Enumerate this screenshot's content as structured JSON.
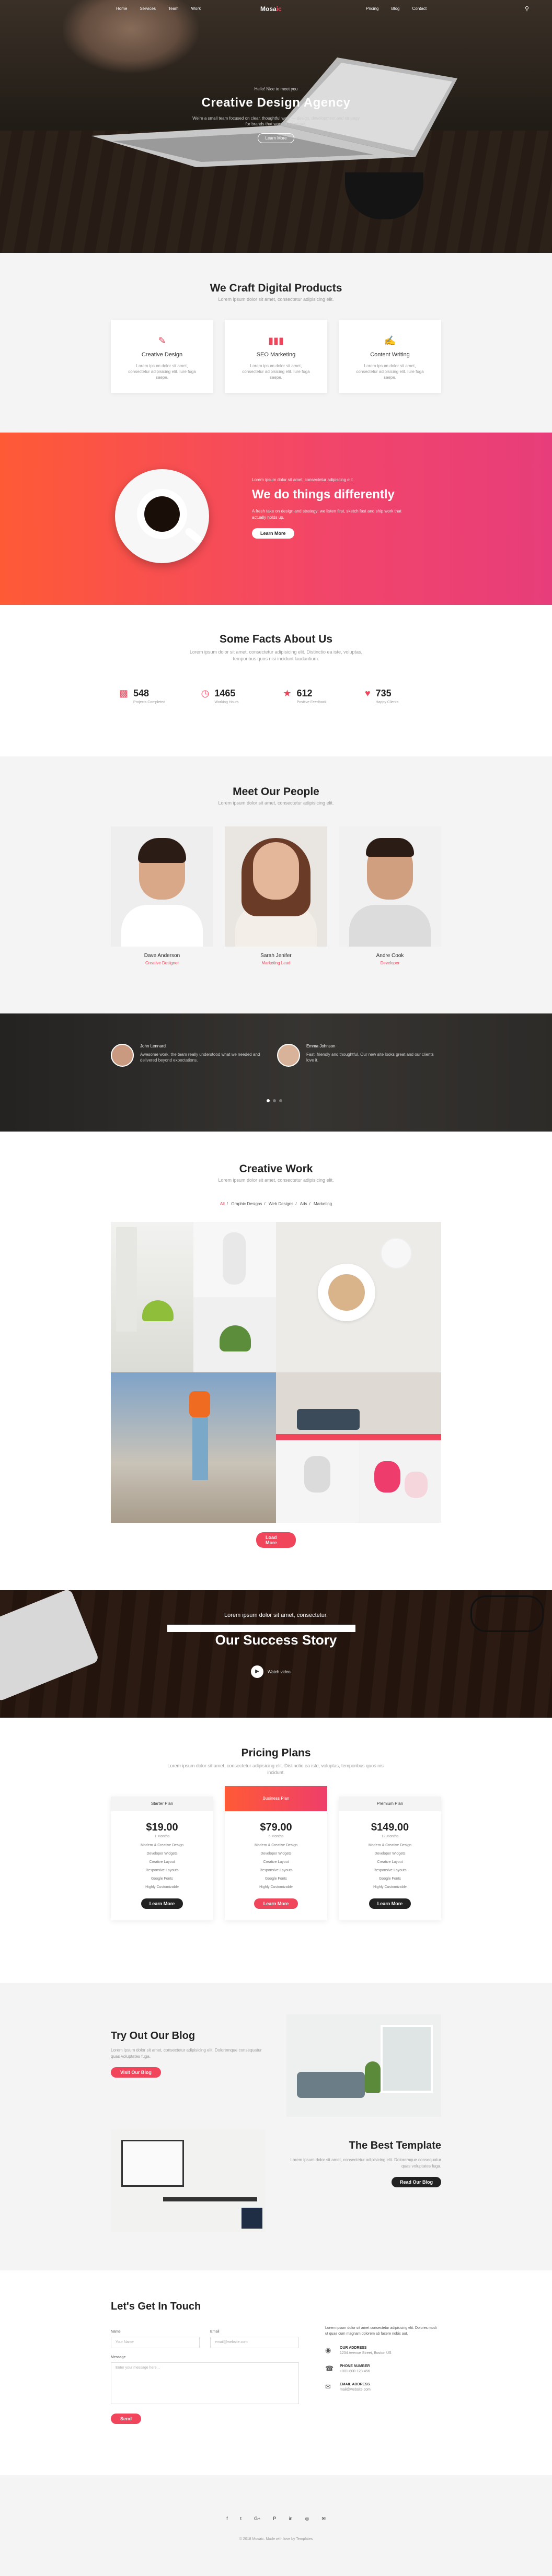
{
  "nav": {
    "logo": "Mosa",
    "logo_accent": "ic",
    "left_links": [
      "Home",
      "Services",
      "Team",
      "Work"
    ],
    "right_links": [
      "Pricing",
      "Blog",
      "Contact"
    ],
    "search_icon": "search-icon"
  },
  "hero": {
    "kicker": "Hello! Nice to meet you",
    "title": "Creative Design Agency",
    "description": "We're a small team focused on clear, thoughtful work — design, development and strategy for brands that want to stand out.",
    "button": "Learn More"
  },
  "services": {
    "title": "We Craft Digital Products",
    "subtitle": "Lorem ipsum dolor sit amet, consectetur adipisicing elit.",
    "items": [
      {
        "icon": "pencil-icon",
        "title": "Creative Design",
        "desc": "Lorem ipsum dolor sit amet, consectetur adipisicing elit. Iure fuga saepe."
      },
      {
        "icon": "chart-icon",
        "title": "SEO Marketing",
        "desc": "Lorem ipsum dolor sit amet, consectetur adipisicing elit. Iure fuga saepe."
      },
      {
        "icon": "edit-icon",
        "title": "Content Writing",
        "desc": "Lorem ipsum dolor sit amet, consectetur adipisicing elit. Iure fuga saepe."
      }
    ]
  },
  "different": {
    "kicker": "Lorem ipsum dolor sit amet, consectetur adipiscing elit.",
    "title": "We do things differently",
    "description": "A fresh take on design and strategy: we listen first, sketch fast and ship work that actually holds up.",
    "button": "Learn More"
  },
  "facts": {
    "title": "Some Facts About Us",
    "subtitle": "Lorem ipsum dolor sit amet, consectetur adipisicing elit. Distinctio ea iste, voluptas, temporibus quos nisi incidunt laudantium.",
    "items": [
      {
        "icon": "briefcase-icon",
        "value": "548",
        "label": "Projects Completed"
      },
      {
        "icon": "clock-icon",
        "value": "1465",
        "label": "Working Hours"
      },
      {
        "icon": "star-icon",
        "value": "612",
        "label": "Positive Feedback"
      },
      {
        "icon": "heart-icon",
        "value": "735",
        "label": "Happy Clients"
      }
    ]
  },
  "team": {
    "title": "Meet Our People",
    "subtitle": "Lorem ipsum dolor sit amet, consectetur adipisicing elit.",
    "members": [
      {
        "name": "Dave Anderson",
        "role": "Creative Designer",
        "shirt": "#f3f3f3"
      },
      {
        "name": "Sarah Jenifer",
        "role": "Marketing Lead",
        "shirt": "#e8e2da"
      },
      {
        "name": "Andre Cook",
        "role": "Developer",
        "shirt": "#ececec"
      }
    ]
  },
  "testimonials": {
    "items": [
      {
        "name": "John Lennard",
        "quote": "Awesome work, the team really understood what we needed and delivered beyond expectations."
      },
      {
        "name": "Emma Johnson",
        "quote": "Fast, friendly and thoughtful. Our new site looks great and our clients love it."
      }
    ]
  },
  "portfolio": {
    "title": "Creative Work",
    "subtitle": "Lorem ipsum dolor sit amet, consectetur adipisicing elit.",
    "filters": [
      "All",
      "Graphic Designs",
      "Web Designs",
      "Ads",
      "Marketing"
    ],
    "button": "Load More"
  },
  "success": {
    "kicker": "Lorem ipsum dolor sit amet, consectetur.",
    "title": "Our Success Story",
    "play_label": "Watch video"
  },
  "pricing": {
    "title": "Pricing Plans",
    "subtitle": "Lorem ipsum dolor sit amet, consectetur adipisicing elit. Distinctio ea iste, voluptas, temporibus quos nisi incidunt.",
    "plans": [
      {
        "name": "Starter Plan",
        "price": "$19.00",
        "period": "1 Months",
        "features": [
          "Modern & Creative Design",
          "Developer Widgets",
          "Creative Layout",
          "Responsive Layouts",
          "Google Fonts",
          "Highly Customizable"
        ],
        "button": "Learn More",
        "featured": false
      },
      {
        "name": "Business Plan",
        "price": "$79.00",
        "period": "6 Months",
        "features": [
          "Modern & Creative Design",
          "Developer Widgets",
          "Creative Layout",
          "Responsive Layouts",
          "Google Fonts",
          "Highly Customizable"
        ],
        "button": "Learn More",
        "featured": true
      },
      {
        "name": "Premium Plan",
        "price": "$149.00",
        "period": "12 Months",
        "features": [
          "Modern & Creative Design",
          "Developer Widgets",
          "Creative Layout",
          "Responsive Layouts",
          "Google Fonts",
          "Highly Customizable"
        ],
        "button": "Learn More",
        "featured": false
      }
    ]
  },
  "blog": {
    "post1": {
      "title": "Try Out Our Blog",
      "desc": "Lorem ipsum dolor sit amet, consectetur adipisicing elit. Doloremque consequatur quas voluptates fuga.",
      "button": "Visit Our Blog"
    },
    "post2": {
      "title": "The Best Template",
      "desc": "Lorem ipsum dolor sit amet, consectetur adipisicing elit. Doloremque consequatur quas voluptates fuga.",
      "button": "Read Our Blog"
    }
  },
  "contact": {
    "title": "Let's Get In Touch",
    "name_label": "Name",
    "name_placeholder": "Your Name",
    "email_label": "Email",
    "email_placeholder": "email@website.com",
    "message_label": "Message",
    "message_placeholder": "Enter your message here...",
    "submit": "Send",
    "intro": "Lorem ipsum dolor sit amet consectetur adipisicing elit. Dolores modi ut quae cum magnam dolorem ab facere nobis aut.",
    "items": [
      {
        "icon": "location-icon",
        "title": "OUR ADDRESS",
        "value": "1234 Avenue Street, Boston US"
      },
      {
        "icon": "phone-icon",
        "title": "PHONE NUMBER",
        "value": "+001-800-123-456"
      },
      {
        "icon": "mail-icon",
        "title": "EMAIL ADDRESS",
        "value": "mail@website.com"
      }
    ]
  },
  "footer": {
    "socials": [
      "f",
      "t",
      "G+",
      "P",
      "in",
      "◎",
      "✉"
    ],
    "copyright": "© 2018 Mosaic. Made with love by Templates"
  },
  "colors": {
    "accent": "#f0455a",
    "gradient_start": "#ff5a36",
    "gradient_end": "#e73d7a"
  }
}
